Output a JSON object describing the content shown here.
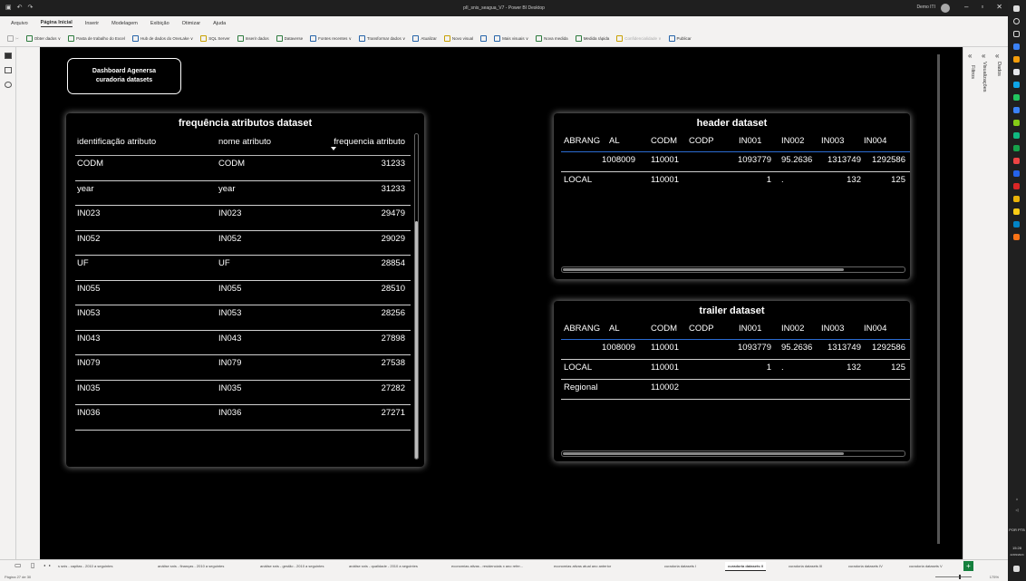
{
  "window": {
    "title": "pII_snis_seagua_V7 - Power BI Desktop",
    "user": "Demo ITI",
    "minimize": "–",
    "maximize": "▫",
    "close": "✕"
  },
  "menu": [
    "Arquivo",
    "Página Inicial",
    "Inserir",
    "Modelagem",
    "Exibição",
    "Otimizar",
    "Ajuda"
  ],
  "ribbon": {
    "obter_dados": "Obter dados ∨",
    "excel": "Pasta de trabalho do Excel",
    "onelake": "Hub de dados do OneLake ∨",
    "sql": "SQL Server",
    "inserir": "Inserir dados",
    "dataverse": "Dataverse",
    "fontes": "Fontes recentes ∨",
    "transformar": "Transformar dados ∨",
    "atualizar": "Atualizar",
    "novo_visual": "Novo visual",
    "caixa": "",
    "mais_visuais": "Mais visuais ∨",
    "nova_medida": "Nova medida",
    "medida_rapida": "Medida rápida",
    "confidencialidade": "Confidencialidade ∨",
    "publicar": "Publicar"
  },
  "dashboard_button": {
    "line1": "Dashboard Agenersa",
    "line2": "curadoria datasets"
  },
  "freq": {
    "title": "frequência atributos dataset",
    "columns": [
      "identificação atributo",
      "nome atributo",
      "frequencia atributo"
    ],
    "rows": [
      {
        "id": "CODM",
        "name": "CODM",
        "freq": "31233"
      },
      {
        "id": "year",
        "name": "year",
        "freq": "31233"
      },
      {
        "id": "IN023",
        "name": "IN023",
        "freq": "29479"
      },
      {
        "id": "IN052",
        "name": "IN052",
        "freq": "29029"
      },
      {
        "id": "UF",
        "name": "UF",
        "freq": "28854"
      },
      {
        "id": "IN055",
        "name": "IN055",
        "freq": "28510"
      },
      {
        "id": "IN053",
        "name": "IN053",
        "freq": "28256"
      },
      {
        "id": "IN043",
        "name": "IN043",
        "freq": "27898"
      },
      {
        "id": "IN079",
        "name": "IN079",
        "freq": "27538"
      },
      {
        "id": "IN035",
        "name": "IN035",
        "freq": "27282"
      },
      {
        "id": "IN036",
        "name": "IN036",
        "freq": "27271"
      }
    ]
  },
  "header_ds": {
    "title": "header dataset",
    "columns": [
      "ABRANG",
      "AL",
      "CODM",
      "CODP",
      "IN001",
      "IN002",
      "IN003",
      "IN004"
    ],
    "rows": [
      [
        "",
        "1008009",
        "110001",
        "",
        "1093779",
        "95.2636",
        "1313749",
        "1292586"
      ],
      [
        "LOCAL",
        "",
        "110001",
        "",
        "1",
        ".",
        "132",
        "125"
      ]
    ]
  },
  "trailer_ds": {
    "title": "trailer dataset",
    "columns": [
      "ABRANG",
      "AL",
      "CODM",
      "CODP",
      "IN001",
      "IN002",
      "IN003",
      "IN004"
    ],
    "rows": [
      [
        "",
        "1008009",
        "110001",
        "",
        "1093779",
        "95.2636",
        "1313749",
        "1292586"
      ],
      [
        "LOCAL",
        "",
        "110001",
        "",
        "1",
        ".",
        "132",
        "125"
      ],
      [
        "Regional",
        "",
        "110002",
        "",
        "",
        "",
        "",
        ""
      ]
    ]
  },
  "panes": {
    "filtros": "Filtros",
    "visualizacoes": "Visualizações",
    "dados": "Dados"
  },
  "tabs": [
    "s snis - capitas - 2010 a seguintes",
    "análise snis - finanças - 2010 a seguintes",
    "análise snis - gestão - 2010 a seguintes",
    "análise snis - qualidade - 2010 a seguintes",
    "economias ativas - residenciais x ano refer...",
    "economias ativas atual ano anterior",
    "curadoria datasets I",
    "curadoria datasets II",
    "curadoria datasets III",
    "curadoria datasets IV",
    "curadoria datasets V"
  ],
  "active_tab_index": 7,
  "status": {
    "page": "Página 27 de 30",
    "zoom": "175%"
  },
  "taskbar": {
    "lang": "POR PTB",
    "time": "15:28",
    "date": "22/09/2024"
  }
}
